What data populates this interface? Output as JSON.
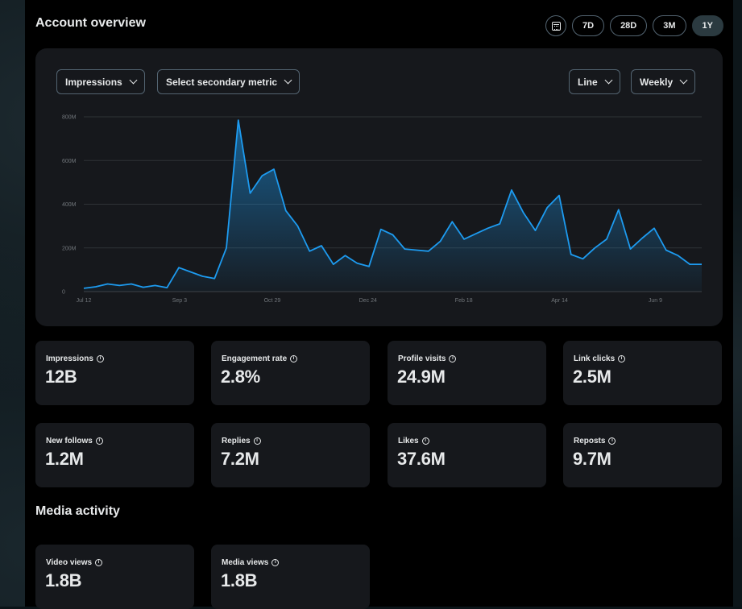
{
  "header": {
    "title": "Account overview",
    "ranges": [
      "7D",
      "28D",
      "3M",
      "1Y"
    ],
    "active_range": "1Y"
  },
  "controls": {
    "primary_metric": "Impressions",
    "secondary_metric": "Select secondary metric",
    "chart_type": "Line",
    "interval": "Weekly"
  },
  "chart_data": {
    "type": "area",
    "title": "",
    "xlabel": "",
    "ylabel": "",
    "ylim": [
      0,
      800
    ],
    "y_unit": "M",
    "y_ticks": [
      "0",
      "200M",
      "400M",
      "600M",
      "800M"
    ],
    "x_ticks": [
      "Jul 12",
      "Sep 3",
      "Oct 29",
      "Dec 24",
      "Feb 18",
      "Apr 14",
      "Jun 9"
    ],
    "grid": true,
    "color": "#1d9bf0",
    "series": [
      {
        "values": [
          15,
          22,
          35,
          28,
          35,
          20,
          28,
          18,
          110,
          90,
          70,
          60,
          200,
          785,
          450,
          530,
          560,
          370,
          300,
          185,
          210,
          125,
          165,
          130,
          115,
          285,
          260,
          195,
          190,
          185,
          230,
          320,
          240,
          265,
          290,
          310,
          465,
          360,
          280,
          385,
          440,
          170,
          150,
          200,
          240,
          375,
          195,
          245,
          290,
          190,
          165,
          125,
          125
        ]
      }
    ]
  },
  "stats": [
    {
      "label": "Impressions",
      "value": "12B"
    },
    {
      "label": "Engagement rate",
      "value": "2.8%"
    },
    {
      "label": "Profile visits",
      "value": "24.9M"
    },
    {
      "label": "Link clicks",
      "value": "2.5M"
    },
    {
      "label": "New follows",
      "value": "1.2M"
    },
    {
      "label": "Replies",
      "value": "7.2M"
    },
    {
      "label": "Likes",
      "value": "37.6M"
    },
    {
      "label": "Reposts",
      "value": "9.7M"
    }
  ],
  "media": {
    "title": "Media activity",
    "stats": [
      {
        "label": "Video views",
        "value": "1.8B"
      },
      {
        "label": "Media views",
        "value": "1.8B"
      }
    ]
  },
  "info_glyph": "i"
}
